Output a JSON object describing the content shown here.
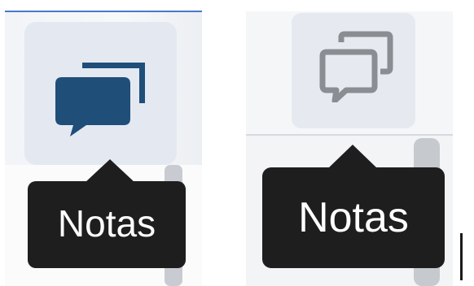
{
  "panels": [
    {
      "state": "active",
      "icon": "chat-bubbles-icon",
      "icon_color": "#1f4e79",
      "tooltip": {
        "label": "Notas"
      }
    },
    {
      "state": "inactive",
      "icon": "chat-bubbles-icon",
      "icon_color": "#8a8d91",
      "tooltip": {
        "label": "Notas"
      }
    }
  ],
  "colors": {
    "tooltip_background": "#1e1e1e",
    "tooltip_text": "#ffffff",
    "button_background": "#e4e9f1",
    "scrollbar_thumb": "#c6c9ce",
    "accent_rule": "#4a78c8"
  }
}
